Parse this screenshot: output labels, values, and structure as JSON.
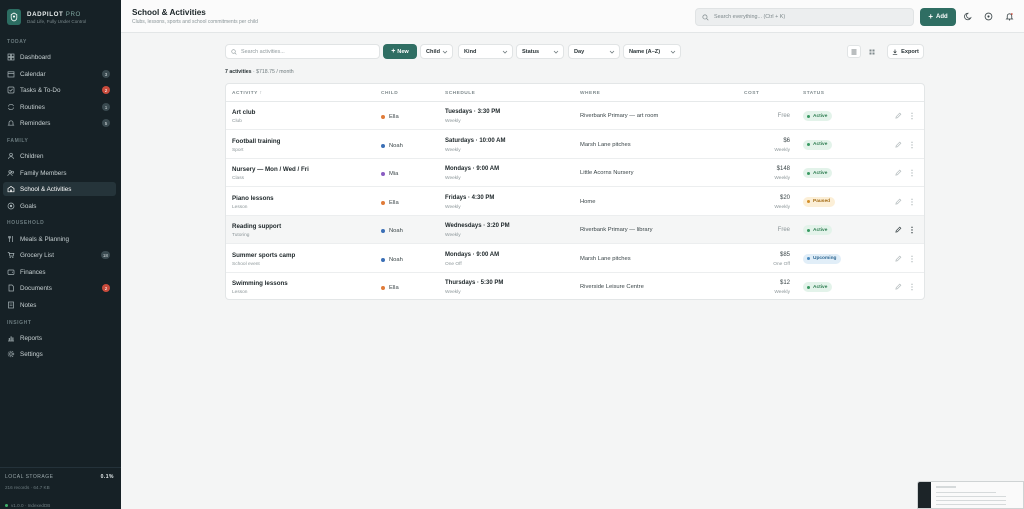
{
  "brand": {
    "name": "DADPILOT",
    "pro": "PRO",
    "tagline": "Dad Life, Fully Under Control"
  },
  "sidebar": {
    "sections": {
      "today": "TODAY",
      "family": "FAMILY",
      "household": "HOUSEHOLD",
      "insight": "INSIGHT"
    },
    "items": [
      {
        "label": "Dashboard",
        "icon": "grid-icon"
      },
      {
        "label": "Calendar",
        "icon": "calendar-icon",
        "badge": "3"
      },
      {
        "label": "Tasks & To-Do",
        "icon": "check-icon",
        "badge": "2",
        "badge_color": "#c84b3c"
      },
      {
        "label": "Routines",
        "icon": "repeat-icon",
        "badge": "1"
      },
      {
        "label": "Reminders",
        "icon": "bell-icon",
        "badge": "5"
      },
      {
        "label": "Children",
        "icon": "child-icon"
      },
      {
        "label": "Family Members",
        "icon": "users-icon"
      },
      {
        "label": "School & Activities",
        "icon": "school-icon",
        "active": true
      },
      {
        "label": "Goals",
        "icon": "target-icon"
      },
      {
        "label": "Meals & Planning",
        "icon": "fork-knife-icon"
      },
      {
        "label": "Grocery List",
        "icon": "cart-icon",
        "badge": "18"
      },
      {
        "label": "Finances",
        "icon": "wallet-icon"
      },
      {
        "label": "Documents",
        "icon": "document-icon",
        "badge": "2",
        "badge_color": "#c84b3c"
      },
      {
        "label": "Notes",
        "icon": "note-icon"
      },
      {
        "label": "Reports",
        "icon": "chart-icon"
      },
      {
        "label": "Settings",
        "icon": "gear-icon"
      }
    ],
    "storage": {
      "label": "LOCAL STORAGE",
      "percent": "0.1%",
      "detail": "216 records · 64.7 KB",
      "version": "v1.0.0 · IndexedDB"
    }
  },
  "header": {
    "title": "School & Activities",
    "subtitle": "Clubs, lessons, sports and school commitments per child",
    "search_placeholder": "Search everything... (Ctrl + K)",
    "add_label": "Add"
  },
  "toolbar": {
    "search_placeholder": "Search activities...",
    "new_label": "New",
    "filters": {
      "child": "Child",
      "kind": "Kind",
      "status": "Status",
      "day": "Day",
      "sort": "Name (A–Z)"
    },
    "export_label": "Export"
  },
  "summary": {
    "count": "7 activities",
    "total": "$718.75 / month"
  },
  "table": {
    "columns": {
      "activity": "ACTIVITY ↑",
      "child": "CHILD",
      "schedule": "SCHEDULE",
      "where": "WHERE",
      "cost": "COST",
      "status": "STATUS"
    },
    "rows": [
      {
        "name": "Art club",
        "kind": "Club",
        "child": "Ella",
        "child_color": "#e07b39",
        "schedule": "Tuesdays · 3:30 PM",
        "freq": "Weekly",
        "where": "Riverbank Primary — art room",
        "cost": "Free",
        "per": "",
        "status": "Active",
        "status_kind": "active"
      },
      {
        "name": "Football training",
        "kind": "Sport",
        "child": "Noah",
        "child_color": "#3b6fb6",
        "schedule": "Saturdays · 10:00 AM",
        "freq": "Weekly",
        "where": "Marsh Lane pitches",
        "cost": "$6",
        "per": "Weekly",
        "status": "Active",
        "status_kind": "active"
      },
      {
        "name": "Nursery — Mon / Wed / Fri",
        "kind": "Class",
        "child": "Mia",
        "child_color": "#8a5cc2",
        "schedule": "Mondays · 9:00 AM",
        "freq": "Weekly",
        "where": "Little Acorns Nursery",
        "cost": "$148",
        "per": "Weekly",
        "status": "Active",
        "status_kind": "active"
      },
      {
        "name": "Piano lessons",
        "kind": "Lesson",
        "child": "Ella",
        "child_color": "#e07b39",
        "schedule": "Fridays · 4:30 PM",
        "freq": "Weekly",
        "where": "Home",
        "cost": "$20",
        "per": "Weekly",
        "status": "Paused",
        "status_kind": "paused"
      },
      {
        "name": "Reading support",
        "kind": "Tutoring",
        "child": "Noah",
        "child_color": "#3b6fb6",
        "schedule": "Wednesdays · 3:20 PM",
        "freq": "Weekly",
        "where": "Riverbank Primary — library",
        "cost": "Free",
        "per": "",
        "status": "Active",
        "status_kind": "active"
      },
      {
        "name": "Summer sports camp",
        "kind": "School event",
        "child": "Noah",
        "child_color": "#3b6fb6",
        "schedule": "Mondays · 9:00 AM",
        "freq": "One Off",
        "where": "Marsh Lane pitches",
        "cost": "$85",
        "per": "One Off",
        "status": "Upcoming",
        "status_kind": "upcoming"
      },
      {
        "name": "Swimming lessons",
        "kind": "Lesson",
        "child": "Ella",
        "child_color": "#e07b39",
        "schedule": "Thursdays · 5:30 PM",
        "freq": "Weekly",
        "where": "Riverside Leisure Centre",
        "cost": "$12",
        "per": "Weekly",
        "status": "Active",
        "status_kind": "active"
      }
    ]
  },
  "colors": {
    "accent": "#2f6e63",
    "sidebar_bg": "#162126",
    "active_status": "#3a9a63",
    "paused_status": "#d3902a",
    "upcoming_status": "#4a8cc0"
  }
}
